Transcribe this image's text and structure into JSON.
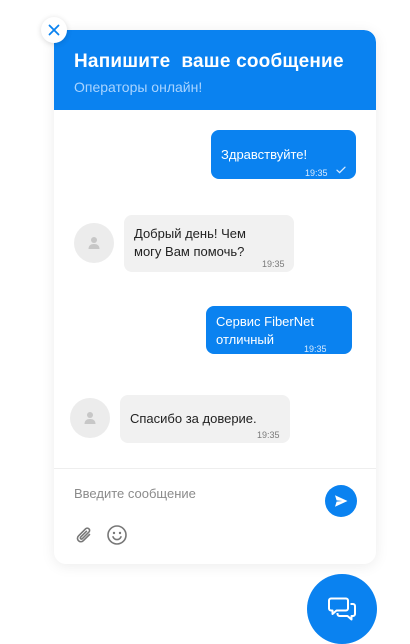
{
  "header": {
    "title": "Напишите  ваше сообщение",
    "subtitle": "Операторы онлайн!"
  },
  "messages": [
    {
      "direction": "out",
      "text": "Здравствуйте!",
      "time": "19:35",
      "read": true
    },
    {
      "direction": "in",
      "text": "Добрый день! Чем могу Вам помочь?",
      "time": "19:35"
    },
    {
      "direction": "out",
      "text": "Сервис FiberNet отличный",
      "time": "19:35"
    },
    {
      "direction": "in",
      "text": "Спасибо за доверие.",
      "time": "19:35"
    }
  ],
  "composer": {
    "placeholder": "Введите сообщение",
    "value": ""
  },
  "icons": {
    "close": "close-icon",
    "avatar": "user-icon",
    "read_receipt": "check-icon",
    "send": "send-icon",
    "attach": "paperclip-icon",
    "emoji": "smiley-icon",
    "launcher": "chat-bubbles-icon"
  },
  "colors": {
    "accent": "#0a82f0",
    "incoming_bubble": "#f1f1f1",
    "subtitle": "#a9d4ff"
  }
}
